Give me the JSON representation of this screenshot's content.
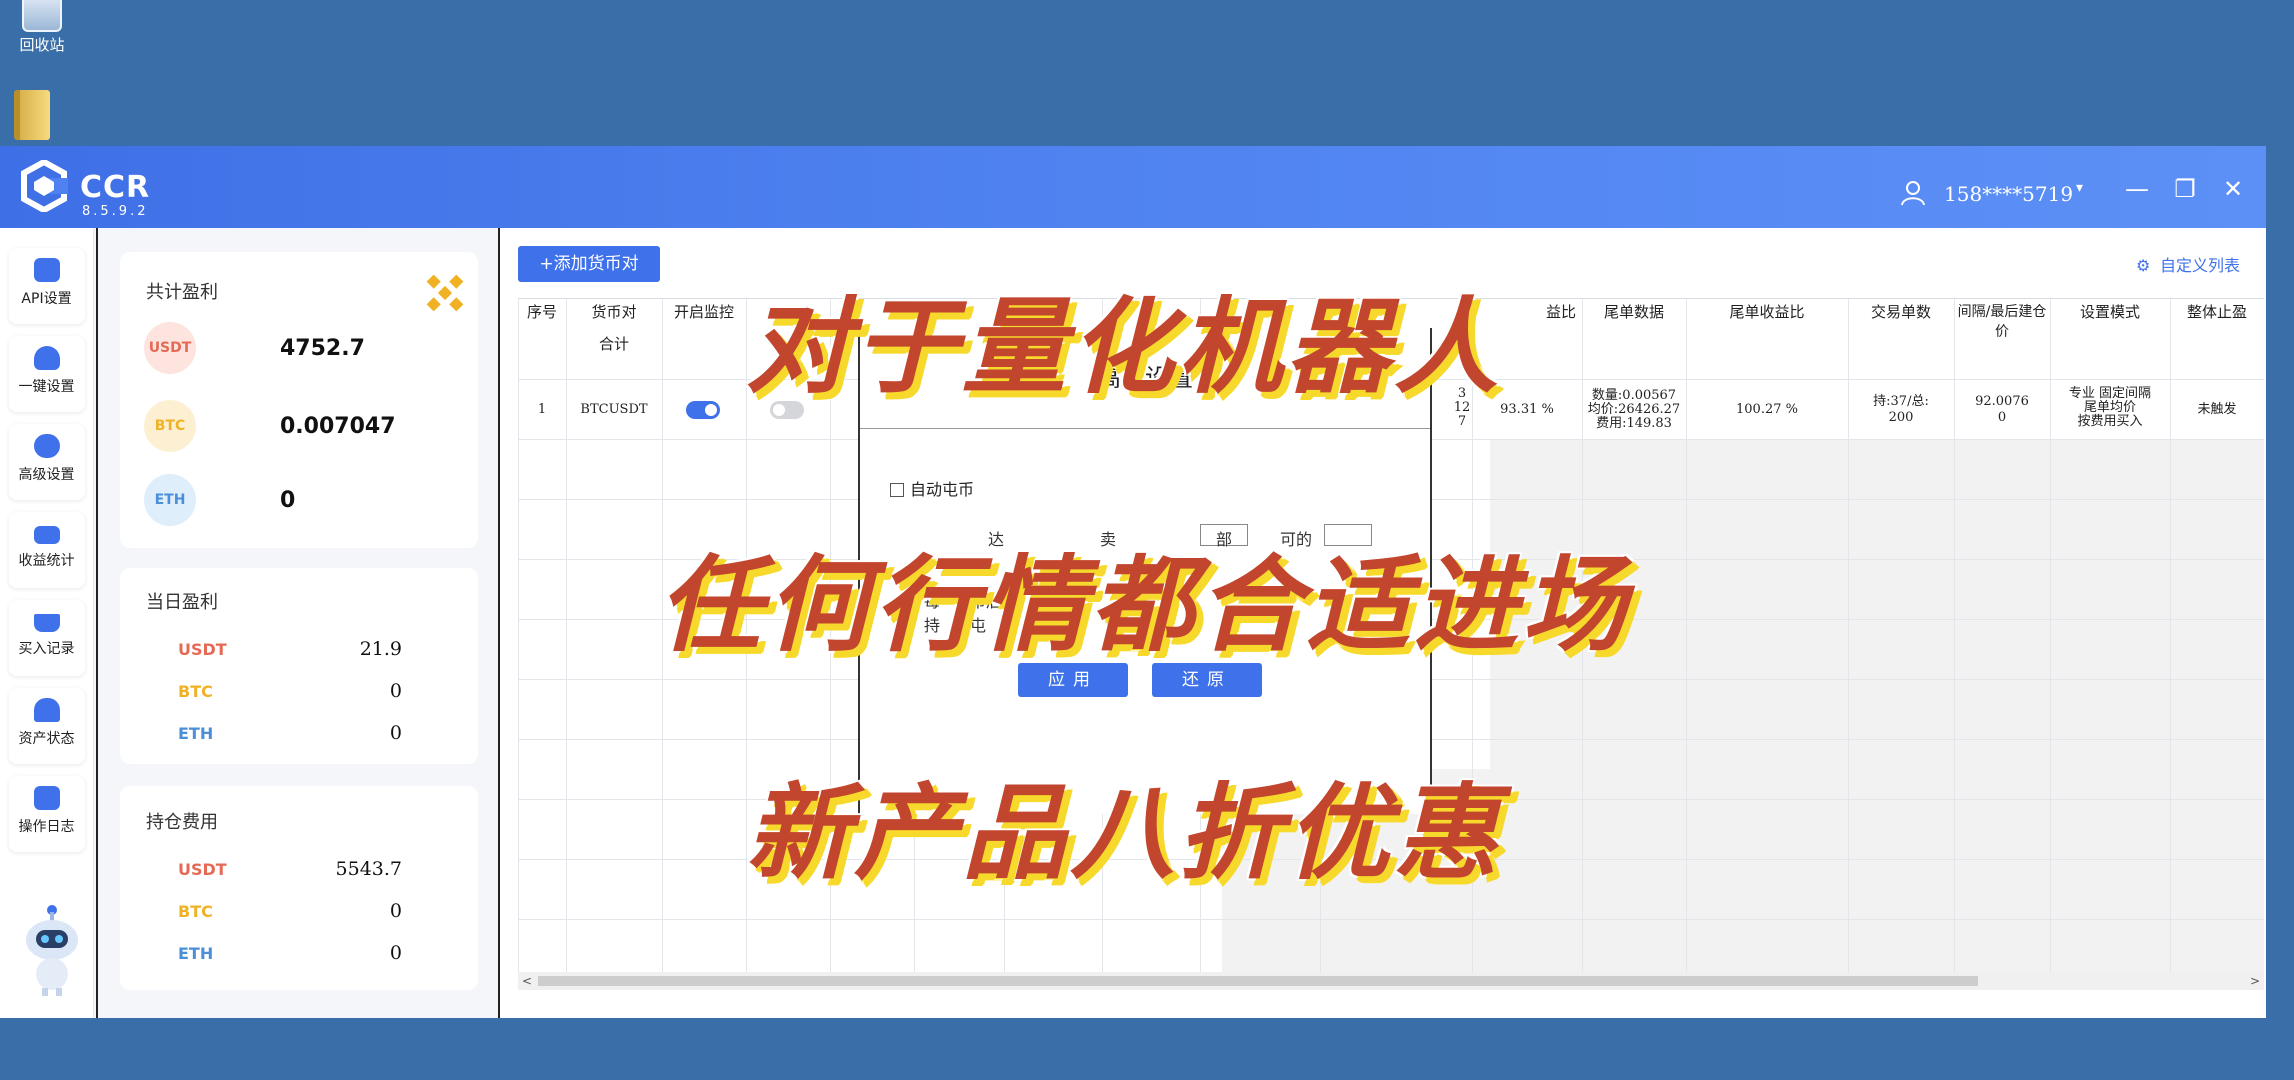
{
  "desktop": {
    "recycle_label": "回收站"
  },
  "window": {
    "app_name": "CCR",
    "version": "8.5.9.2",
    "user": "158****5719",
    "controls": {
      "minimize": "—",
      "restore": "❐",
      "close": "✕"
    }
  },
  "sidebar": {
    "items": [
      {
        "label": "API设置",
        "icon": "api-settings-icon"
      },
      {
        "label": "一键设置",
        "icon": "bulb-icon"
      },
      {
        "label": "高级设置",
        "icon": "gear-icon"
      },
      {
        "label": "收益统计",
        "icon": "card-icon"
      },
      {
        "label": "买入记录",
        "icon": "cart-icon"
      },
      {
        "label": "资产状态",
        "icon": "home-icon"
      },
      {
        "label": "操作日志",
        "icon": "log-icon"
      }
    ]
  },
  "summary": {
    "total": {
      "title": "共计盈利",
      "usdt_label": "USDT",
      "usdt": "4752.7",
      "btc_label": "BTC",
      "btc": "0.007047",
      "eth_label": "ETH",
      "eth": "0"
    },
    "daily": {
      "title": "当日盈利",
      "usdt_label": "USDT",
      "usdt": "21.9",
      "btc_label": "BTC",
      "btc": "0",
      "eth_label": "ETH",
      "eth": "0"
    },
    "holding": {
      "title": "持仓费用",
      "usdt_label": "USDT",
      "usdt": "5543.7",
      "btc_label": "BTC",
      "btc": "0",
      "eth_label": "ETH",
      "eth": "0"
    }
  },
  "main": {
    "add_button": "+添加货币对",
    "custom_list": "自定义列表",
    "headers": {
      "index": "序号",
      "pair": "货币对",
      "monitor": "开启监控",
      "profit_ratio": "益比",
      "tail_data": "尾单数据",
      "tail_ratio": "尾单收益比",
      "trade_count": "交易单数",
      "interval": "间隔/最后建仓价",
      "mode": "设置模式",
      "stop": "整体止盈"
    },
    "total_label": "合计",
    "row1": {
      "index": "1",
      "pair": "BTCUSDT",
      "partial_a": "3",
      "partial_b": "12",
      "partial_c": "7",
      "profit_ratio": "93.31 %",
      "tail_qty": "数量:0.00567",
      "tail_avg": "均价:26426.27",
      "tail_fee": "费用:149.83",
      "tail_ratio": "100.27 %",
      "trades_a": "持:37/总:",
      "trades_b": "200",
      "interval_a": "92.0076",
      "interval_b": "0",
      "mode_a": "专业 固定间隔",
      "mode_b": "尾单均价",
      "mode_c": "按费用买入",
      "stop": "未触发"
    }
  },
  "dialog": {
    "title": "高级设置",
    "auto_coin": "自动屯币",
    "frag_1": "达",
    "frag_2": "卖",
    "frag_3": "部",
    "frag_4": "可的",
    "frag_5": "每",
    "frag_6": "币后",
    "frag_7": "持",
    "frag_8": "屯",
    "apply": "应用",
    "reset": "还原"
  },
  "promo": {
    "line1": "对于量化机器人",
    "line2": "任何行情都合适进场",
    "line3": "新产品八折优惠"
  },
  "colors": {
    "accent": "#3f72ea",
    "usdt": "#e56a55",
    "btc": "#f0b224",
    "eth": "#4a8fd8",
    "promo": "#c2452d"
  }
}
